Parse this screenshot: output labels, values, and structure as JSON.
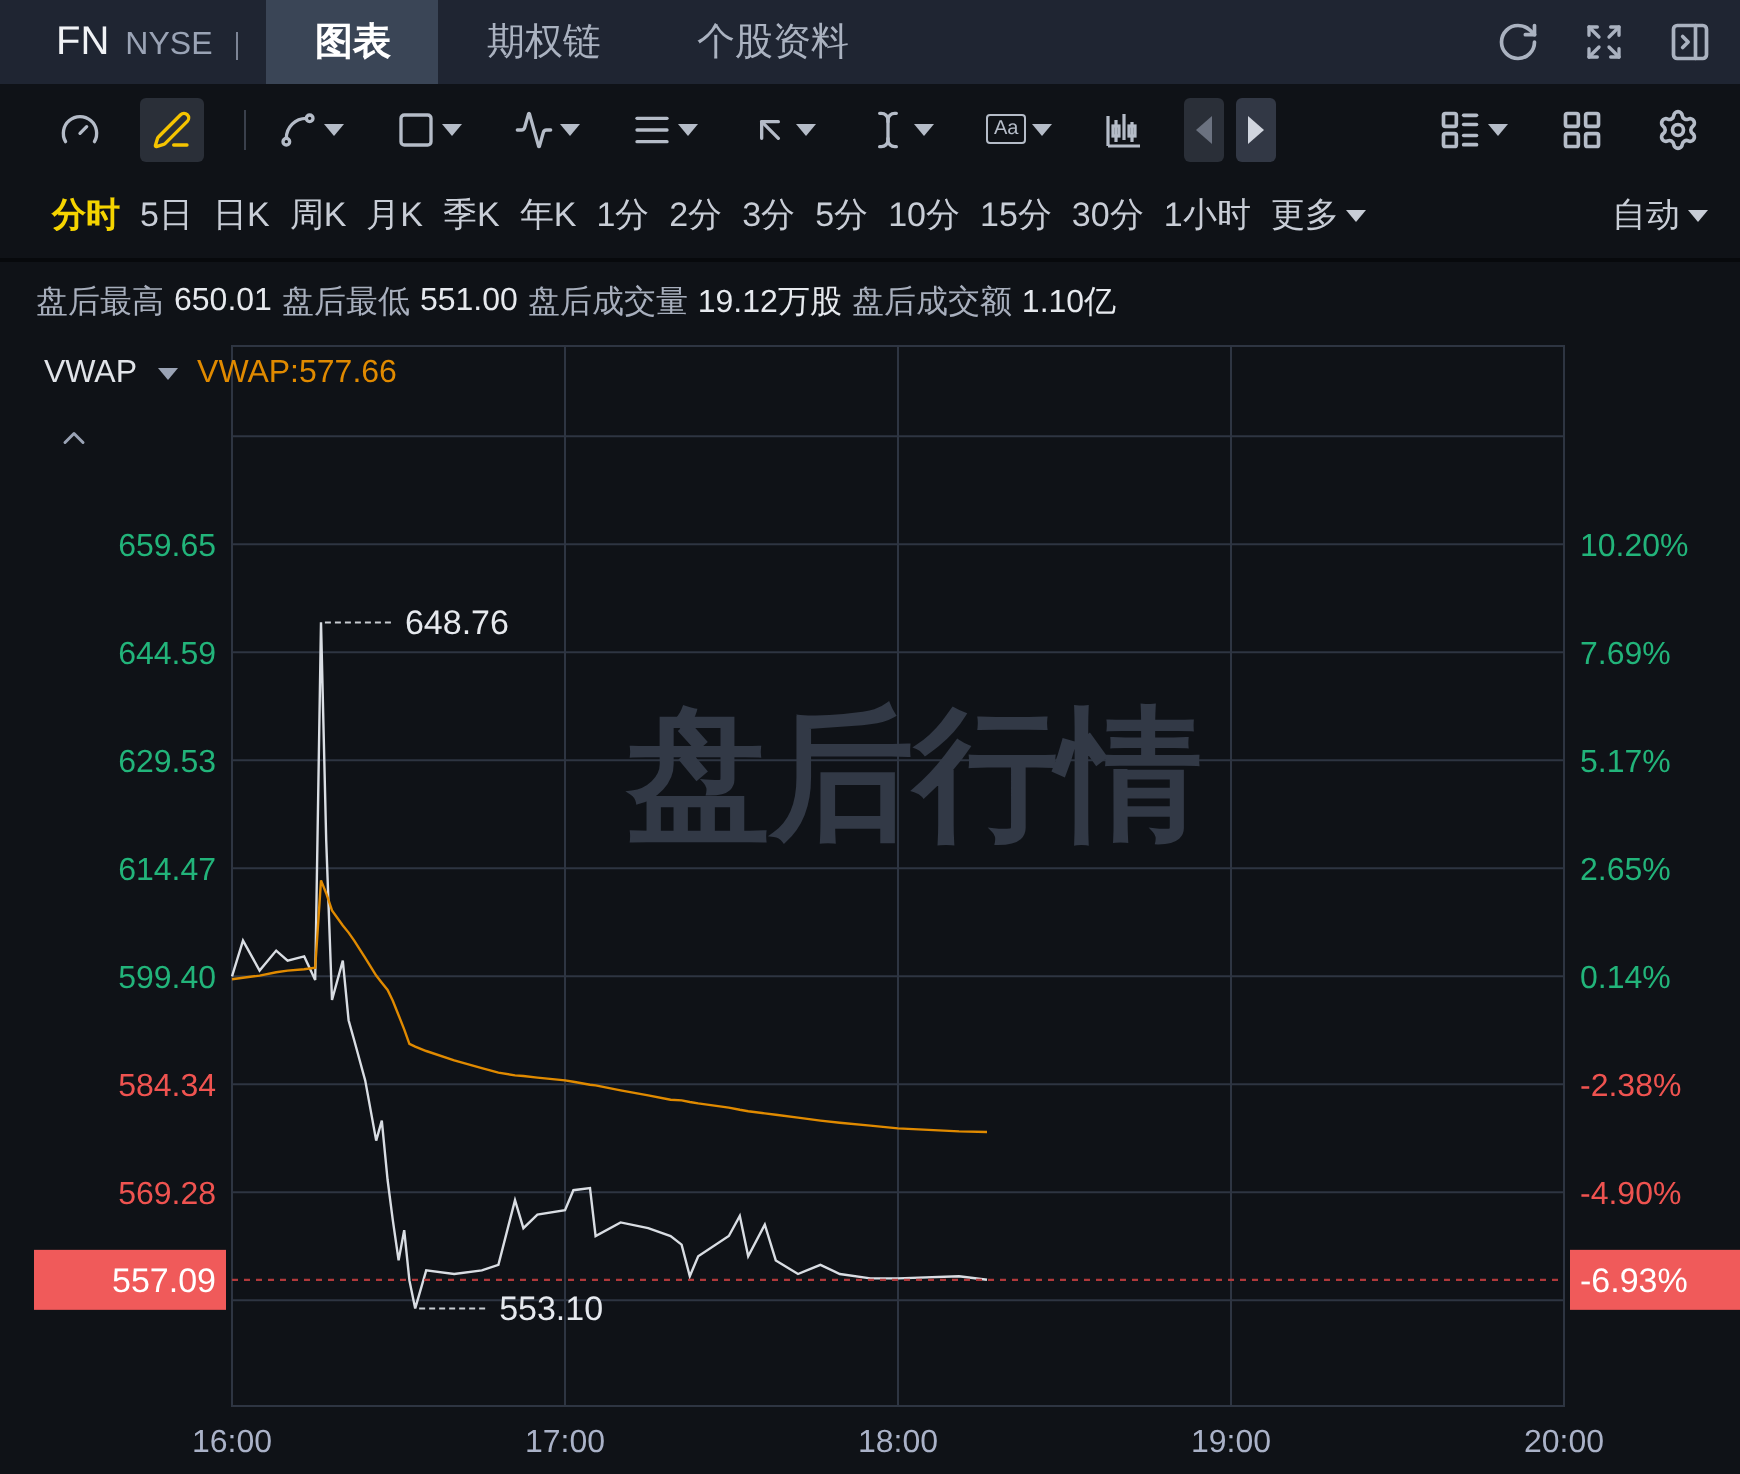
{
  "header": {
    "symbol": "FN",
    "exchange": "NYSE",
    "tabs": [
      {
        "label": "图表",
        "selected": true
      },
      {
        "label": "期权链",
        "selected": false
      },
      {
        "label": "个股资料",
        "selected": false
      }
    ]
  },
  "toolbar": {
    "tools": [
      {
        "menu": false,
        "selected": false
      },
      {
        "menu": false,
        "selected": true
      },
      {
        "menu": true,
        "selected": false
      },
      {
        "menu": true,
        "selected": false
      },
      {
        "menu": true,
        "selected": false
      },
      {
        "menu": true,
        "selected": false
      },
      {
        "menu": true,
        "selected": false
      },
      {
        "menu": true,
        "selected": false
      },
      {
        "menu": true,
        "selected": false,
        "label": "Aa"
      }
    ],
    "nav": [
      {
        "disabled": true
      },
      {
        "disabled": false
      }
    ]
  },
  "periods": [
    {
      "label": "分时",
      "selected": true
    },
    {
      "label": "5日",
      "selected": false
    },
    {
      "label": "日K",
      "selected": false
    },
    {
      "label": "周K",
      "selected": false
    },
    {
      "label": "月K",
      "selected": false
    },
    {
      "label": "季K",
      "selected": false
    },
    {
      "label": "年K",
      "selected": false
    },
    {
      "label": "1分",
      "selected": false
    },
    {
      "label": "2分",
      "selected": false
    },
    {
      "label": "3分",
      "selected": false
    },
    {
      "label": "5分",
      "selected": false
    },
    {
      "label": "10分",
      "selected": false
    },
    {
      "label": "15分",
      "selected": false
    },
    {
      "label": "30分",
      "selected": false
    },
    {
      "label": "1小时",
      "selected": false
    },
    {
      "label": "更多",
      "selected": false,
      "menu": true
    }
  ],
  "scale_mode": "自动",
  "stats": [
    {
      "label": "盘后最高",
      "value": "650.01"
    },
    {
      "label": "盘后最低",
      "value": "551.00"
    },
    {
      "label": "盘后成交量",
      "value": "19.12万股"
    },
    {
      "label": "盘后成交额",
      "value": "1.10亿"
    }
  ],
  "indicator": {
    "reading": "VWAP:577.66"
  },
  "chart": {
    "overlay_text": "盘后行情",
    "last_price": "557.09",
    "last_percent": "-6.93%",
    "percent_labels": [
      {
        "label": "10.20%",
        "color": "#22b47a"
      },
      {
        "label": "7.69%",
        "color": "#22b47a"
      },
      {
        "label": "5.17%",
        "color": "#22b47a"
      },
      {
        "label": "2.65%",
        "color": "#22b47a"
      },
      {
        "label": "0.14%",
        "color": "#22b47a"
      },
      {
        "label": "-2.38%",
        "color": "#ef5350"
      },
      {
        "label": "-4.90%",
        "color": "#ef5350"
      }
    ],
    "chart_data": {
      "type": "line",
      "grid": true,
      "ref_lines": [
        {
          "axis": "y",
          "value": 557.09,
          "color": "#b0393b"
        }
      ],
      "xlim": [
        16,
        20
      ],
      "ylim": [
        539.5,
        687.3
      ],
      "x": [
        16,
        16.033,
        16.083,
        16.133,
        16.167,
        16.217,
        16.25,
        16.267,
        16.283,
        16.3,
        16.333,
        16.35,
        16.367,
        16.4,
        16.433,
        16.45,
        16.467,
        16.483,
        16.5,
        16.517,
        16.533,
        16.55,
        16.583,
        16.667,
        16.75,
        16.8,
        16.85,
        16.875,
        16.917,
        17,
        17.025,
        17.075,
        17.092,
        17.167,
        17.25,
        17.317,
        17.35,
        17.375,
        17.4,
        17.492,
        17.525,
        17.55,
        17.6,
        17.633,
        17.7,
        17.767,
        17.825,
        17.917,
        18,
        18.183,
        18.267
      ],
      "series": [
        {
          "color": "#d9dde3",
          "values": [
            599.4,
            604.4,
            600.2,
            603,
            601.6,
            602.2,
            598.9,
            648.8,
            618.4,
            596.1,
            601.6,
            593.3,
            590.5,
            584.9,
            576.5,
            579.3,
            571,
            565.4,
            559.8,
            564,
            557,
            553.1,
            558.4,
            557.9,
            558.4,
            559.2,
            568.2,
            564.3,
            566.2,
            566.8,
            569.6,
            569.9,
            563.2,
            565.1,
            564.3,
            563.2,
            562,
            557.6,
            560.4,
            563.2,
            566,
            560.4,
            564.8,
            559.8,
            557.9,
            559.2,
            557.9,
            557.3,
            557.3,
            557.6,
            557.1
          ]
        },
        {
          "name": "VWAP",
          "color": "#e08a00",
          "values": [
            599,
            599.2,
            599.5,
            600,
            600.2,
            600.4,
            600.6,
            612.8,
            611,
            608.6,
            606.5,
            605.5,
            604.4,
            602,
            599.5,
            598.5,
            597.5,
            596,
            594,
            592,
            590,
            589.6,
            589,
            587.7,
            586.6,
            586,
            585.6,
            585.5,
            585.3,
            584.9,
            584.7,
            584.3,
            584.2,
            583.5,
            582.8,
            582.2,
            582.1,
            581.9,
            581.7,
            581.1,
            580.8,
            580.6,
            580.3,
            580.1,
            579.7,
            579.3,
            579,
            578.6,
            578.2,
            577.8,
            577.7
          ]
        }
      ],
      "xticks": [
        {
          "value": 16,
          "label": "16:00"
        },
        {
          "value": 17,
          "label": "17:00"
        },
        {
          "value": 18,
          "label": "18:00"
        },
        {
          "value": 19,
          "label": "19:00"
        },
        {
          "value": 20,
          "label": "20:00"
        }
      ],
      "yticks": [
        {
          "value": 659.65,
          "label": "659.65"
        },
        {
          "value": 644.59,
          "label": "644.59"
        },
        {
          "value": 629.53,
          "label": "629.53"
        },
        {
          "value": 614.47,
          "label": "614.47"
        },
        {
          "value": 599.4,
          "label": "599.40"
        },
        {
          "value": 584.34,
          "label": "584.34"
        },
        {
          "value": 569.28,
          "label": "569.28"
        }
      ],
      "annotations": [
        {
          "x": 16.267,
          "y": 648.76,
          "text": "648.76"
        },
        {
          "x": 16.55,
          "y": 553.1,
          "text": "553.10"
        }
      ]
    }
  }
}
